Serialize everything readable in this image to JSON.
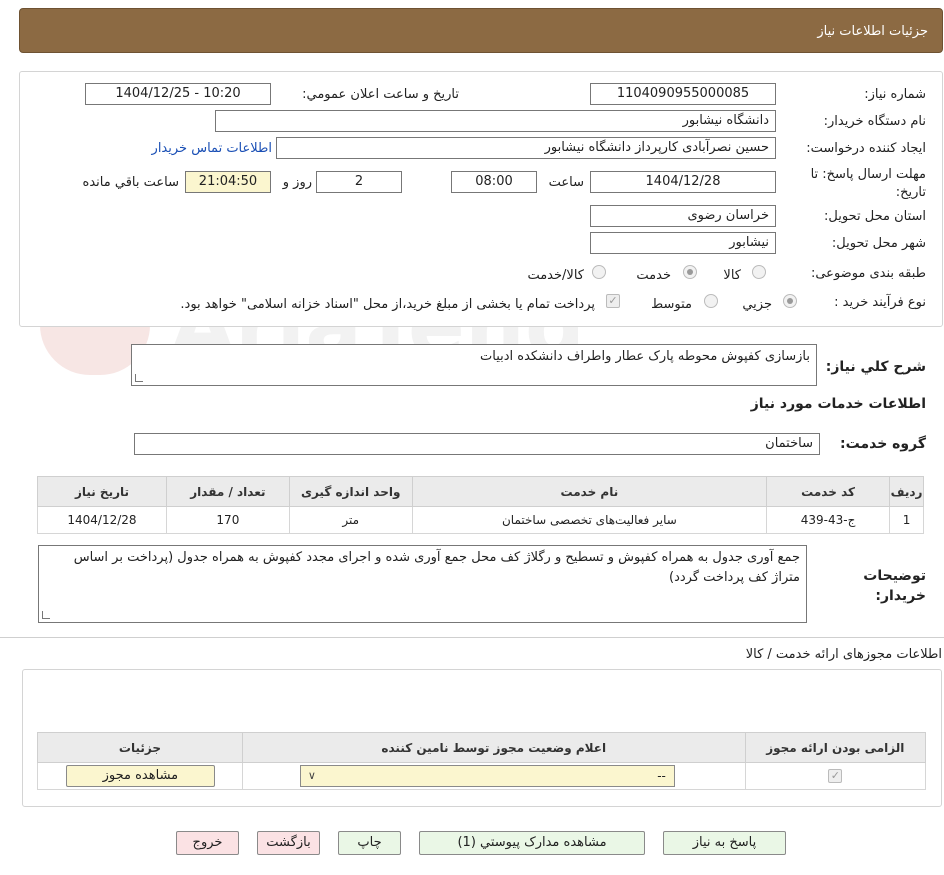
{
  "header": {
    "title": "جزئیات اطلاعات نیاز"
  },
  "form": {
    "need_number_label": "شماره نیاز:",
    "need_number": "1104090955000085",
    "announce_label": "تاریخ و ساعت اعلان عمومي:",
    "announce_value": "1404/12/25 - 10:20",
    "buyer_org_label": "نام دستگاه خریدار:",
    "buyer_org": "دانشگاه نیشابور",
    "creator_label": "ایجاد کننده درخواست:",
    "creator": "حسین نصرآبادی کارپرداز دانشگاه نیشابور",
    "contact_link": "اطلاعات تماس خریدار",
    "deadline_label": "مهلت ارسال پاسخ: تا تاریخ:",
    "deadline_date": "1404/12/28",
    "time_label": "ساعت",
    "deadline_time": "08:00",
    "days_value": "2",
    "days_label": "روز و",
    "remaining_time": "21:04:50",
    "remaining_label": "ساعت باقي مانده",
    "province_label": "استان محل تحویل:",
    "province": "خراسان رضوی",
    "city_label": "شهر محل تحویل:",
    "city": "نیشابور",
    "category_label": "طبقه بندی موضوعی:",
    "category_options": [
      "کالا",
      "خدمت",
      "کالا/خدمت"
    ],
    "process_label": "نوع فرآیند خرید :",
    "process_options": [
      "جزيي",
      "متوسط"
    ],
    "payment_note": "پرداخت تمام یا بخشی از مبلغ خرید،از محل \"اسناد خزانه اسلامی\" خواهد بود."
  },
  "summary": {
    "label": "شرح کلي نیاز:",
    "text": "بازسازی کفپوش محوطه پارک عطار واطراف دانشکده ادبیات"
  },
  "services": {
    "section_title": "اطلاعات خدمات مورد نیاز",
    "group_label": "گروه خدمت:",
    "group_value": "ساختمان",
    "columns": [
      "ردیف",
      "کد خدمت",
      "نام خدمت",
      "واحد اندازه گیری",
      "تعداد / مقدار",
      "تاریخ نیاز"
    ],
    "rows": [
      [
        "1",
        "ج-43-439",
        "سایر فعالیت‌های تخصصی ساختمان",
        "متر",
        "170",
        "1404/12/28"
      ]
    ]
  },
  "buyer_notes": {
    "label": "توضیحات خریدار:",
    "text": "جمع آوری جدول به همراه کفپوش و تسطیح و رگلاژ کف محل جمع آوری شده و اجرای مجدد کفپوش به همراه جدول (پرداخت بر اساس متراژ کف پرداخت گردد)"
  },
  "permits": {
    "section_title": "اطلاعات مجوزهای ارائه خدمت / کالا",
    "columns": [
      "الزامی بودن ارائه مجوز",
      "اعلام وضعیت مجوز توسط نامین کننده",
      "جزئیات"
    ],
    "select_value": "--",
    "view_button": "مشاهده مجوز"
  },
  "actions": {
    "reply": "پاسخ به نیاز",
    "attachments": "مشاهده مدارک پیوستي (1)",
    "print": "چاپ",
    "back": "بازگشت",
    "exit": "خروج"
  },
  "watermark_text": "AriaTender.neT"
}
